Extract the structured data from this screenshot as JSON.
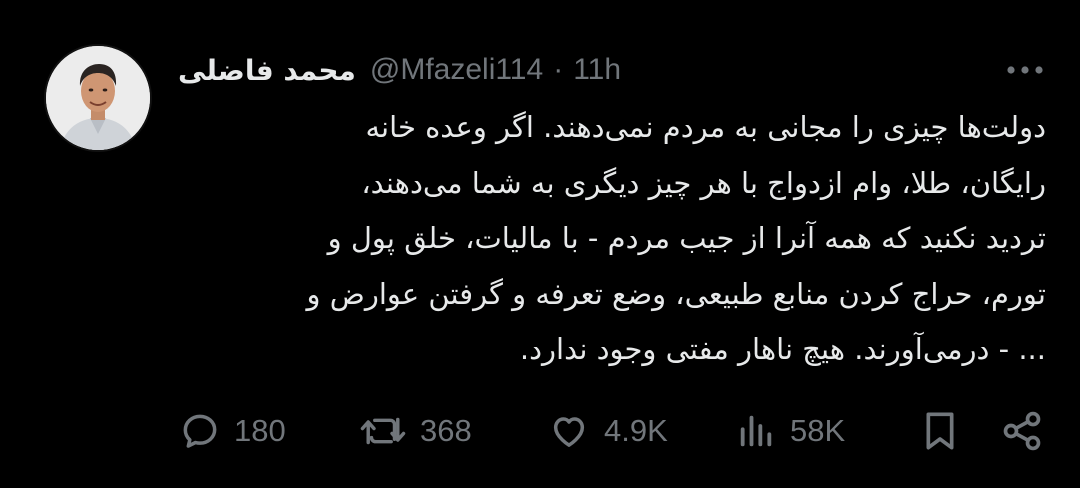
{
  "tweet": {
    "author": {
      "display_name": "محمد فاضلی",
      "handle": "@Mfazeli114",
      "separator": "·",
      "time": "11h",
      "avatar_icon": "profile-photo"
    },
    "text_lines": [
      "دولت‌ها چیزی را مجانی به مردم نمی‌دهند. اگر وعده خانه",
      "رایگان، طلا، وام ازدواج با هر چیز دیگری به شما می‌دهند،",
      "تردید نکنید که همه آنرا از جیب مردم - با مالیات، خلق پول و",
      "تورم، حراج کردن منابع طبیعی، وضع تعرفه و گرفتن عوارض و",
      "... - درمی‌آورند. هیچ ناهار مفتی وجود ندارد."
    ],
    "stats": {
      "replies": "180",
      "retweets": "368",
      "likes": "4.9K",
      "views": "58K"
    },
    "icons": {
      "more": "more-icon",
      "reply": "reply-icon",
      "retweet": "retweet-icon",
      "like": "like-icon",
      "views": "views-icon",
      "bookmark": "bookmark-icon",
      "share": "share-icon"
    },
    "colors": {
      "background": "#000000",
      "text": "#e7e9ea",
      "secondary": "#71767b"
    }
  }
}
